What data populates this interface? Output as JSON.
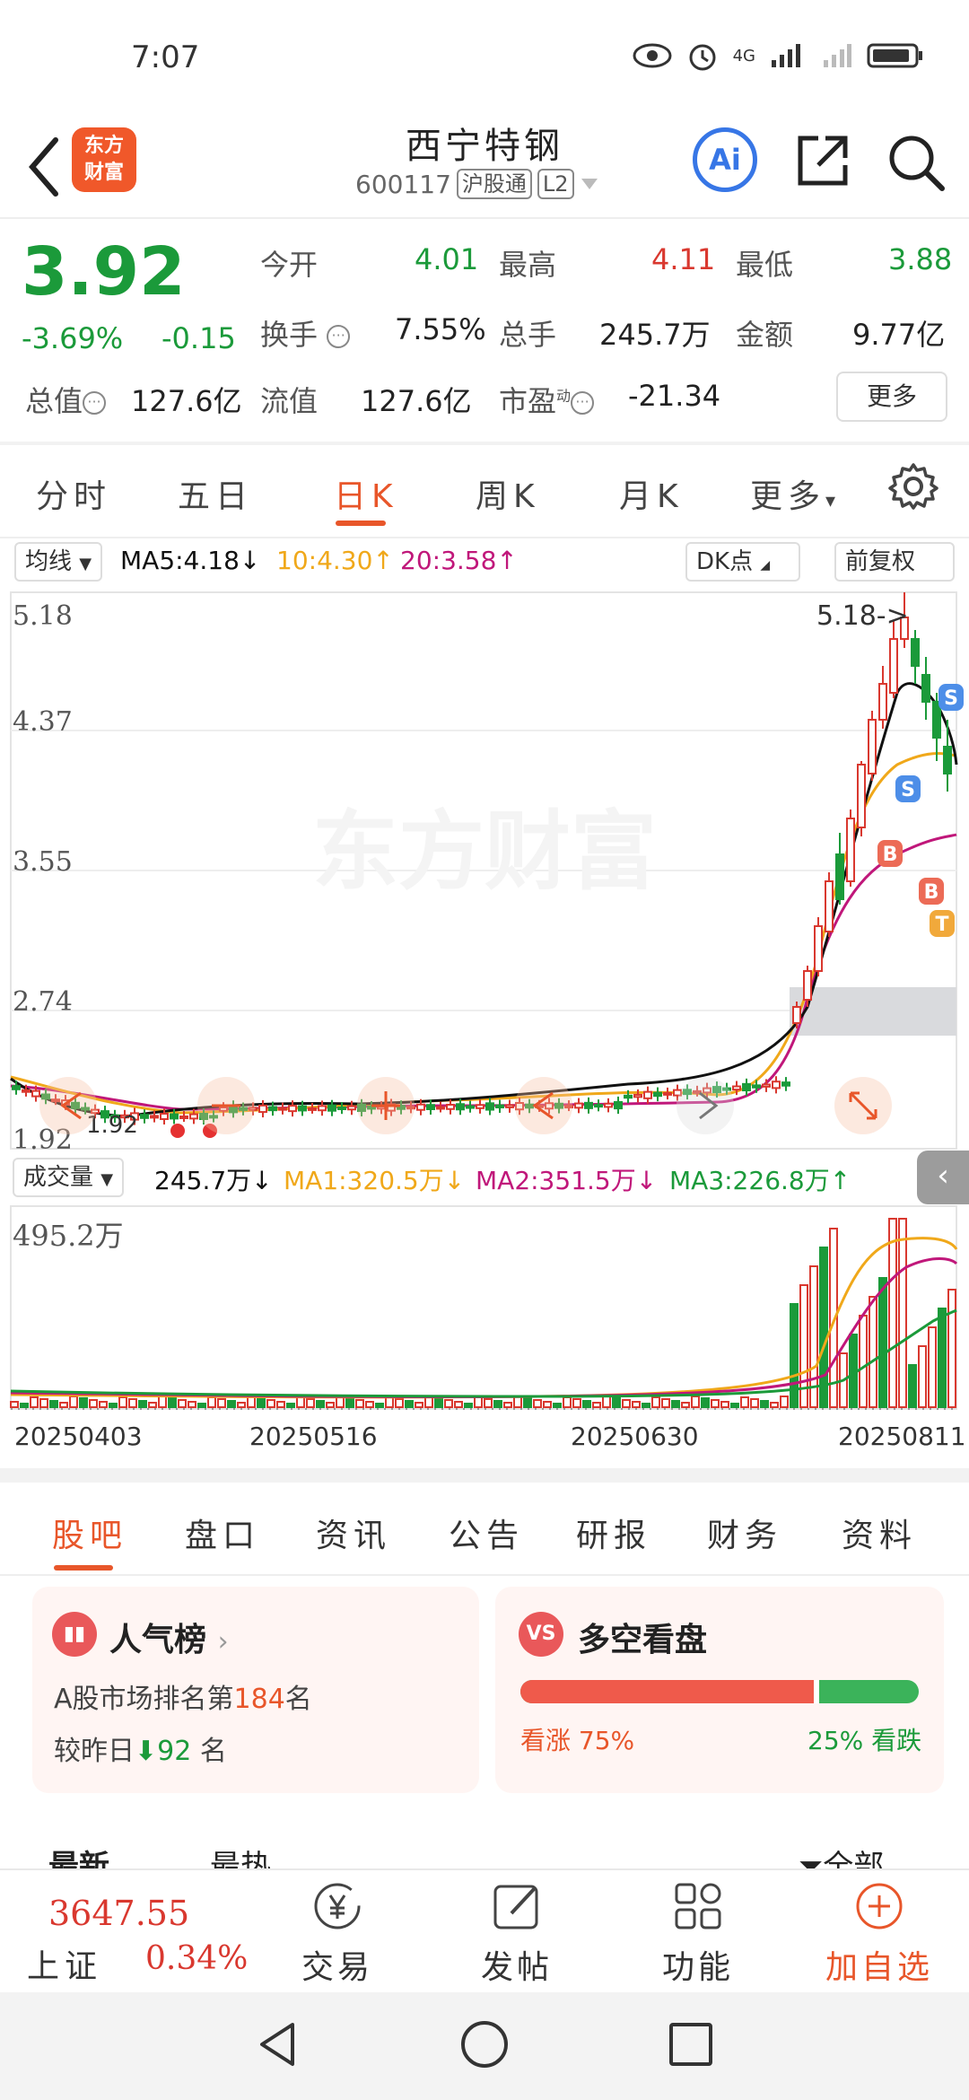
{
  "status_bar": {
    "time": "7:07",
    "network": "4G"
  },
  "header": {
    "logo_text_line1": "东方",
    "logo_text_line2": "财富",
    "stock_name": "西宁特钢",
    "stock_code": "600117",
    "tag_connect": "沪股通",
    "tag_level": "L2",
    "ai_label": "Ai"
  },
  "quote": {
    "price": "3.92",
    "change_pct": "-3.69%",
    "change_amt": "-0.15",
    "open_label": "今开",
    "open": "4.01",
    "high_label": "最高",
    "high": "4.11",
    "low_label": "最低",
    "low": "3.88",
    "turnover_label": "换手",
    "turnover": "7.55%",
    "volume_label": "总手",
    "volume": "245.7万",
    "amount_label": "金额",
    "amount": "9.77亿",
    "mktcap_label": "总值",
    "mktcap": "127.6亿",
    "float_label": "流值",
    "float_cap": "127.6亿",
    "pe_label": "市盈",
    "pe_sup": "动",
    "pe": "-21.34",
    "more_btn": "更多"
  },
  "period_tabs": [
    "分时",
    "五日",
    "日K",
    "周K",
    "月K",
    "更多"
  ],
  "ma_row": {
    "select": "均线",
    "ma5": "MA5:4.18",
    "ma5_arrow": "↓",
    "ma10": "10:4.30",
    "ma10_arrow": "↑",
    "ma20": "20:3.58",
    "ma20_arrow": "↑",
    "dk": "DK点",
    "adjust": "前复权"
  },
  "kline": {
    "y_labels": [
      "5.18",
      "4.37",
      "3.55",
      "2.74",
      "1.92"
    ],
    "max_label": "5.18->",
    "min_label": "1.92",
    "watermark": "东方财富",
    "marker_b": "B",
    "marker_s": "S",
    "marker_t": "T"
  },
  "volume_row": {
    "select": "成交量",
    "vol": "245.7万",
    "vol_arrow": "↓",
    "ma1": "MA1:320.5万",
    "ma1_arrow": "↓",
    "ma2": "MA2:351.5万",
    "ma2_arrow": "↓",
    "ma3": "MA3:226.8万",
    "ma3_arrow": "↑",
    "max_label": "495.2万"
  },
  "dates": [
    "20250403",
    "20250516",
    "20250630",
    "20250811"
  ],
  "content_tabs": [
    "股吧",
    "盘口",
    "资讯",
    "公告",
    "研报",
    "财务",
    "资料"
  ],
  "popularity_card": {
    "title": "人气榜",
    "rank_prefix": "A股市场排名第",
    "rank": "184",
    "rank_suffix": "名",
    "yesterday_prefix": "较昨日",
    "yesterday_change": "92",
    "yesterday_suffix": "名"
  },
  "sentiment_card": {
    "title": "多空看盘",
    "bull_label": "看涨",
    "bull_pct": "75%",
    "bear_pct": "25%",
    "bear_label": "看跌",
    "bull_fraction": 0.75
  },
  "partial_row": {
    "left1": "最新",
    "left2": "最热",
    "right": "全部"
  },
  "bottom_nav": {
    "index_value": "3647.55",
    "index_name": "上证",
    "index_pct": "0.34%",
    "trade": "交易",
    "post": "发帖",
    "functions": "功能",
    "add_watch": "加自选"
  },
  "colors": {
    "up": "#d9382f",
    "down": "#1b9a3a",
    "accent": "#e8562a",
    "ma5": "#111111",
    "ma10": "#f0a81a",
    "ma20": "#c0177a"
  }
}
